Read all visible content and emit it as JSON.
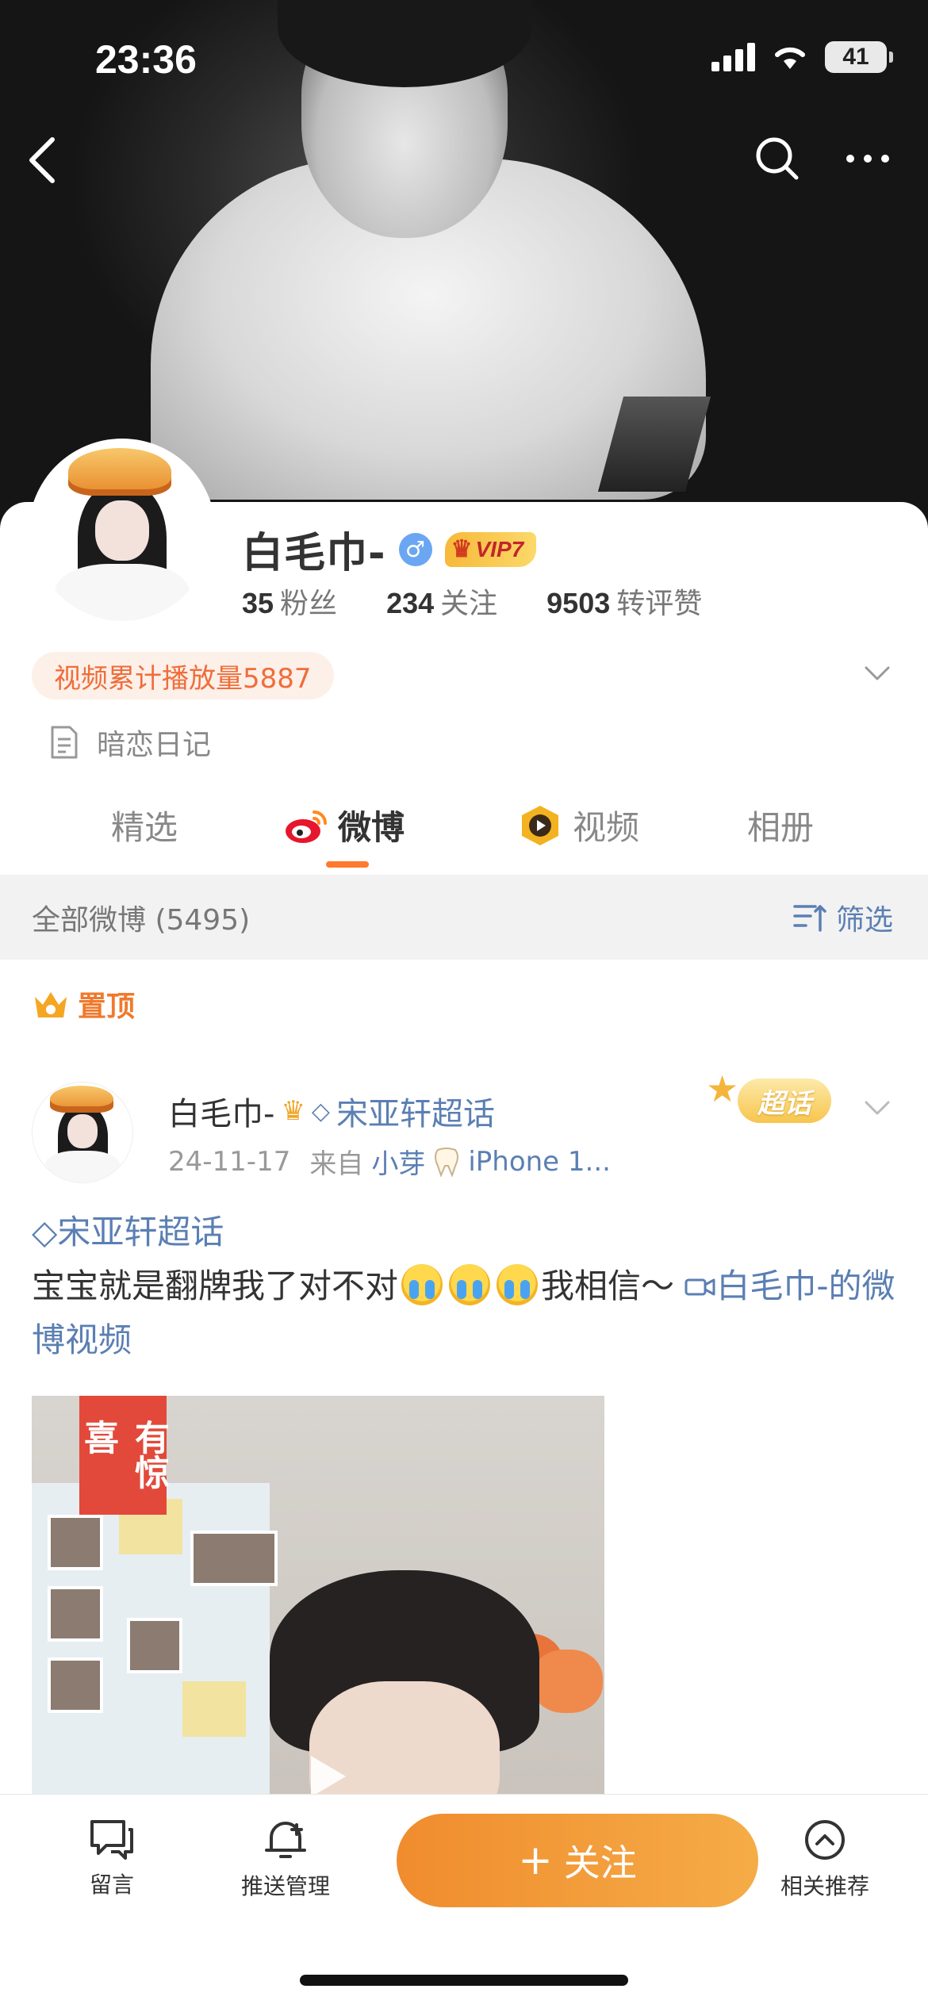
{
  "status_bar": {
    "time": "23:36",
    "battery": "41"
  },
  "profile": {
    "name": "白毛巾-",
    "vip_label": "VIP7",
    "gender_symbol": "♂",
    "stats": [
      {
        "value": "35",
        "label": "粉丝"
      },
      {
        "value": "234",
        "label": "关注"
      },
      {
        "value": "9503",
        "label": "转评赞"
      }
    ],
    "play_count_tag": "视频累计播放量5887",
    "intro": "暗恋日记"
  },
  "tabs": [
    {
      "label": "精选",
      "active": false
    },
    {
      "label": "微博",
      "active": true
    },
    {
      "label": "视频",
      "active": false
    },
    {
      "label": "相册",
      "active": false
    }
  ],
  "filter_bar": {
    "count_label": "全部微博 (5495)",
    "filter_label": "筛选"
  },
  "pinned_label": "置顶",
  "post": {
    "author": "白毛巾-",
    "topic": "宋亚轩超话",
    "date": "24-11-17",
    "source_prefix": "来自",
    "source_name": "小芽",
    "source_device": "iPhone 1...",
    "supertopic_badge": "超话",
    "body_topic": "宋亚轩超话",
    "body_text_before": "宝宝就是翻牌我了对不对",
    "body_text_after": "我相信～",
    "body_link": "白毛巾-的微博视频",
    "media_banner": "有惊喜"
  },
  "bottom_bar": {
    "message": "留言",
    "push": "推送管理",
    "follow": "关注",
    "recommend": "相关推荐"
  },
  "colors": {
    "accent_orange": "#ef7a2d",
    "link_blue": "#5b7fb3",
    "follow_gradient_start": "#f08c2e",
    "follow_gradient_end": "#f5ac47"
  }
}
